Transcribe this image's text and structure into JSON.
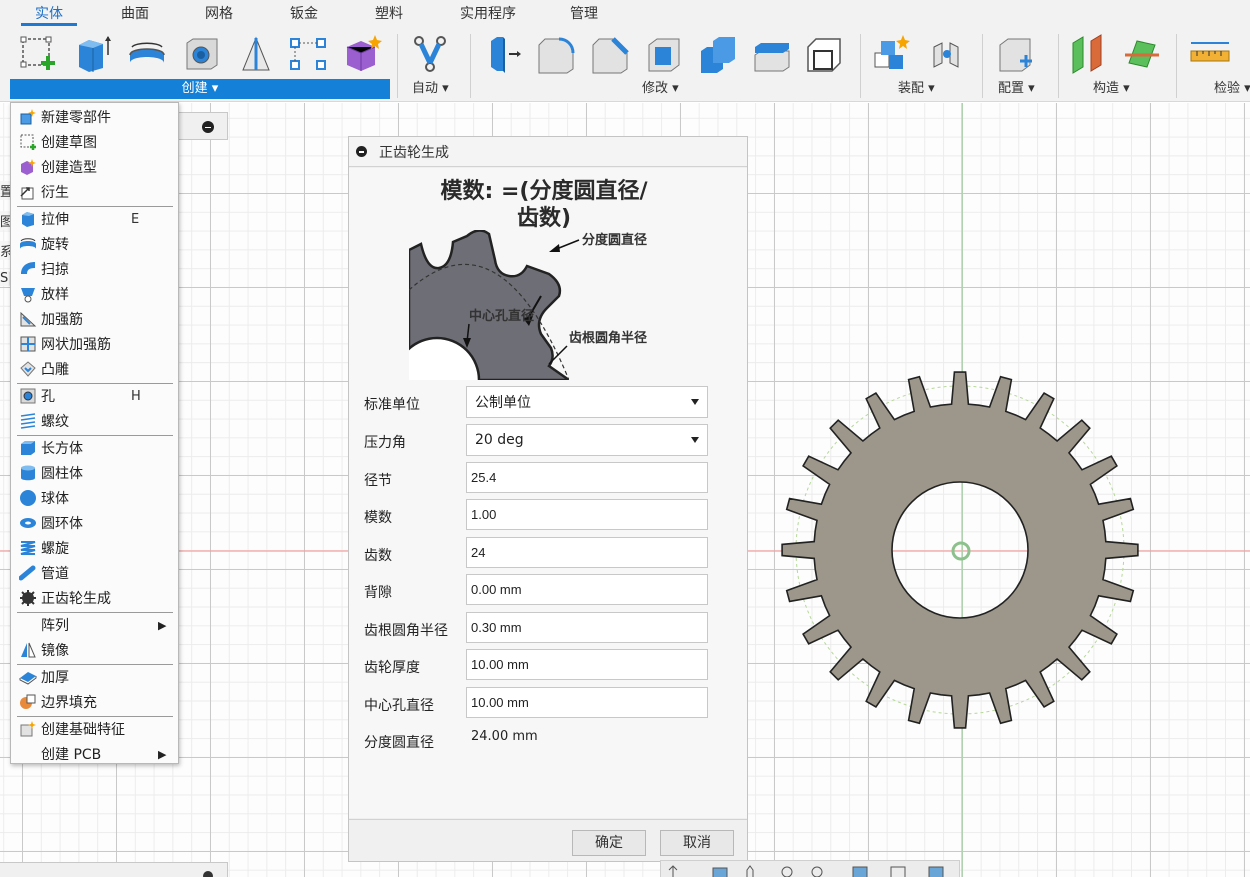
{
  "tabs": [
    {
      "label": "实体",
      "active": true
    },
    {
      "label": "曲面",
      "active": false
    },
    {
      "label": "网格",
      "active": false
    },
    {
      "label": "钣金",
      "active": false
    },
    {
      "label": "塑料",
      "active": false
    },
    {
      "label": "实用程序",
      "active": false
    },
    {
      "label": "管理",
      "active": false
    }
  ],
  "ribbon": {
    "create_label": "创建 ▾",
    "groups": {
      "automate": "自动 ▾",
      "modify": "修改 ▾",
      "assemble": "装配 ▾",
      "configure": "配置 ▾",
      "construct": "构造 ▾",
      "inspect": "检验 ▾"
    }
  },
  "viewport_left_fragments": [
    "置",
    "图",
    "系",
    "S|"
  ],
  "create_menu": {
    "items": [
      {
        "label": "新建零部件",
        "icon": "new-component-icon"
      },
      {
        "label": "创建草图",
        "icon": "create-sketch-icon"
      },
      {
        "label": "创建造型",
        "icon": "create-form-icon"
      },
      {
        "label": "衍生",
        "icon": "derive-icon"
      },
      {
        "label": "拉伸",
        "icon": "extrude-icon",
        "shortcut": "E"
      },
      {
        "label": "旋转",
        "icon": "revolve-icon"
      },
      {
        "label": "扫掠",
        "icon": "sweep-icon"
      },
      {
        "label": "放样",
        "icon": "loft-icon"
      },
      {
        "label": "加强筋",
        "icon": "rib-icon"
      },
      {
        "label": "网状加强筋",
        "icon": "web-icon"
      },
      {
        "label": "凸雕",
        "icon": "emboss-icon"
      },
      {
        "label": "孔",
        "icon": "hole-icon",
        "shortcut": "H"
      },
      {
        "label": "螺纹",
        "icon": "thread-icon"
      },
      {
        "label": "长方体",
        "icon": "box-icon"
      },
      {
        "label": "圆柱体",
        "icon": "cylinder-icon"
      },
      {
        "label": "球体",
        "icon": "sphere-icon"
      },
      {
        "label": "圆环体",
        "icon": "torus-icon"
      },
      {
        "label": "螺旋",
        "icon": "coil-icon"
      },
      {
        "label": "管道",
        "icon": "pipe-icon"
      },
      {
        "label": "正齿轮生成",
        "icon": "spur-gear-icon"
      },
      {
        "label": "阵列",
        "icon": "",
        "submenu": true
      },
      {
        "label": "镜像",
        "icon": "mirror-icon"
      },
      {
        "label": "加厚",
        "icon": "thicken-icon"
      },
      {
        "label": "边界填充",
        "icon": "boundary-fill-icon"
      },
      {
        "label": "创建基础特征",
        "icon": "base-feature-icon"
      },
      {
        "label": "创建 PCB",
        "icon": "",
        "submenu": true
      }
    ]
  },
  "dialog": {
    "title": "正齿轮生成",
    "formula_line1": "模数: =(分度圆直径/",
    "formula_line2": "齿数)",
    "diagram_labels": {
      "pitch_diameter": "分度圆直径",
      "bore_diameter": "中心孔直径",
      "root_fillet": "齿根圆角半径"
    },
    "fields": {
      "standard": {
        "label": "标准单位",
        "value": "公制单位"
      },
      "pressure_angle": {
        "label": "压力角",
        "value": "20 deg"
      },
      "diametral_pitch": {
        "label": "径节",
        "value": "25.4"
      },
      "module": {
        "label": "模数",
        "value": "1.00"
      },
      "teeth": {
        "label": "齿数",
        "value": "24"
      },
      "backlash": {
        "label": "背隙",
        "value": "0.00 mm"
      },
      "root_fillet": {
        "label": "齿根圆角半径",
        "value": "0.30 mm"
      },
      "thickness": {
        "label": "齿轮厚度",
        "value": "10.00 mm"
      },
      "bore": {
        "label": "中心孔直径",
        "value": "10.00 mm"
      },
      "pitch_diameter": {
        "label": "分度圆直径",
        "value": "24.00 mm"
      }
    },
    "ok_label": "确定",
    "cancel_label": "取消"
  },
  "colors": {
    "accent": "#1f78d1",
    "gear_fill": "#9c978a",
    "axis_red": "#f2a0a0",
    "axis_green": "#9fd89f"
  }
}
